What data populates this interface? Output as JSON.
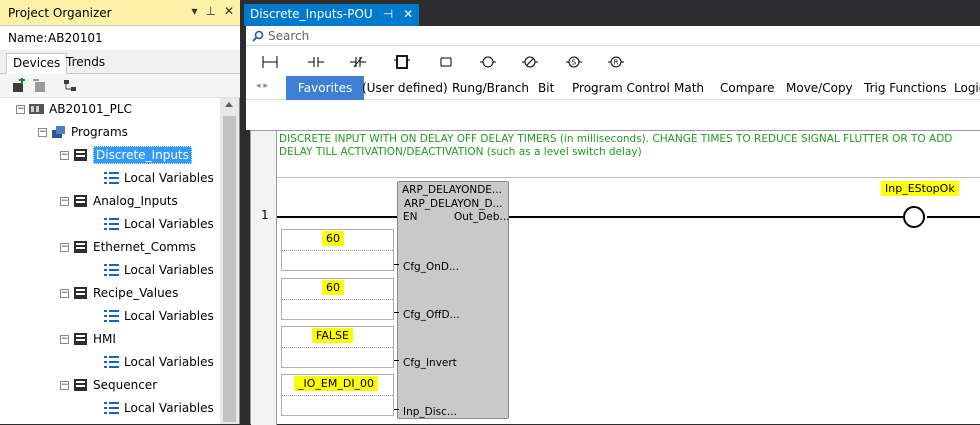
{
  "left_panel": {
    "title": "Project Organizer",
    "controls": [
      "▾",
      "⊥",
      "✕"
    ],
    "name_label": "Name:",
    "name_value": "AB20101",
    "tabs": [
      "Devices",
      "Trends"
    ]
  },
  "tree": {
    "root": "AB20101_PLC",
    "programs": "Programs",
    "items": [
      {
        "label": "Discrete_Inputs",
        "child": "Local Variables"
      },
      {
        "label": "Analog_Inputs",
        "child": "Local Variables"
      },
      {
        "label": "Ethernet_Comms",
        "child": "Local Variables"
      },
      {
        "label": "Recipe_Values",
        "child": "Local Variables"
      },
      {
        "label": "HMI",
        "child": "Local Variables"
      },
      {
        "label": "Sequencer",
        "child": "Local Variables"
      }
    ]
  },
  "doc_tab": {
    "title": "Discrete_Inputs-POU",
    "pin": "⊣",
    "close": "✕"
  },
  "search": {
    "placeholder": "Search"
  },
  "categories": [
    "Favorites",
    "(User defined)",
    "Rung/Branch",
    "Bit",
    "Program Control",
    "Math",
    "Compare",
    "Move/Copy",
    "Trig Functions",
    "Logic"
  ],
  "ladder": {
    "comment": "DISCRETE INPUT WITH ON DELAY OFF DELAY TIMERS (in milliseconds).  CHANGE TIMES TO REDUCE SIGNAL FLUTTER OR TO ADD DELAY TILL ACTIVATION/DEACTIVATION (such as a level switch delay)",
    "rung_number": "1",
    "fb_type": "ARP_DELAYONDE...",
    "fb_instance": "ARP_DELAYON_D...",
    "pin_en": "EN",
    "pin_out": "Out_Deb...",
    "inputs": [
      {
        "value": "60",
        "pin": "Cfg_OnD..."
      },
      {
        "value": "60",
        "pin": "Cfg_OffD..."
      },
      {
        "value": "FALSE",
        "pin": "Cfg_Invert"
      },
      {
        "value": "_IO_EM_DI_00",
        "pin": "Inp_Disc..."
      }
    ],
    "coil_label": "Inp_EStopOk"
  },
  "colors": {
    "accent": "#007acc",
    "selection": "#3399ff",
    "comment": "#1e9c1e",
    "highlight": "#ffff00"
  }
}
